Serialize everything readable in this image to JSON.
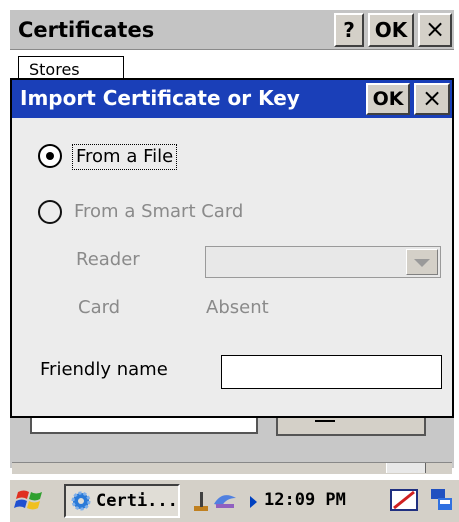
{
  "parent_window": {
    "title": "Certificates",
    "help_label": "?",
    "ok_label": "OK",
    "close_label": "×",
    "tab_label": "Stores"
  },
  "dialog": {
    "title": "Import Certificate or Key",
    "ok_label": "OK",
    "close_label": "×",
    "option_file": {
      "label": "From a File",
      "selected": true
    },
    "option_smart_card": {
      "label": "From a Smart Card",
      "selected": false,
      "enabled": false
    },
    "reader_label": "Reader",
    "reader_value": "",
    "card_label": "Card",
    "card_status": "Absent",
    "friendly_name_label": "Friendly name",
    "friendly_name_value": ""
  },
  "taskbar": {
    "start_icon": "windows-flag-icon",
    "task_label": "Certi...",
    "task_icon": "certificate-gear-icon",
    "clock": "12:09 PM",
    "tray_icons": [
      "network-icon",
      "input-panel-icon",
      "desktop-icon"
    ]
  },
  "colors": {
    "dialog_title_bg": "#1a3fb8",
    "dialog_bg": "#ececec",
    "button_face": "#d4d0c8",
    "disabled_text": "#8a8a8a"
  }
}
